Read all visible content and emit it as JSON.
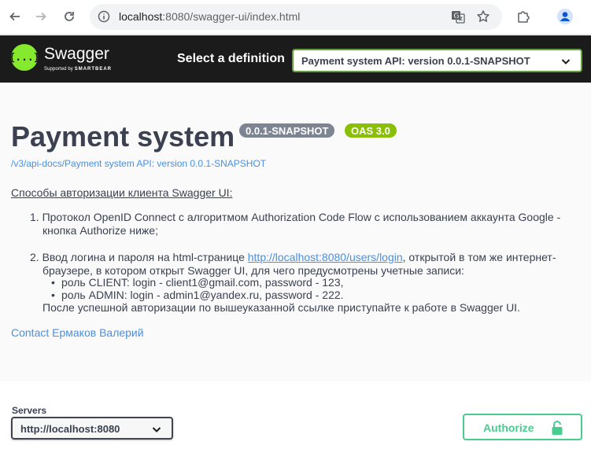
{
  "browser": {
    "url_host": "localhost",
    "url_rest": ":8080/swagger-ui/index.html"
  },
  "topbar": {
    "brand": "Swagger",
    "brand_sub_prefix": "Supported by",
    "brand_sub_company": "SMARTBEAR",
    "select_label": "Select a definition",
    "definition_selected": "Payment system API: version 0.0.1-SNAPSHOT"
  },
  "info": {
    "title": "Payment system",
    "version_badge": "0.0.1-SNAPSHOT",
    "oas_badge": "OAS 3.0",
    "spec_link": "/v3/api-docs/Payment system API: version 0.0.1-SNAPSHOT",
    "desc_heading": "Способы авторизации клиента Swagger UI:",
    "item1_line1": "1. Протокол OpenID Connect с алгоритмом Authorization Code Flow с использованием аккаунта Google -",
    "item1_line2": "кнопка Authorize ниже;",
    "item2_prefix": "2. Ввод логина и пароля на html-странице ",
    "item2_link": "http://localhost:8080/users/login",
    "item2_suffix": ", открытой в том же интернет-",
    "item2_line2": "браузере, в котором открыт Swagger UI, для чего предусмотрены учетные записи:",
    "bullet1": "роль CLIENT: login - client1@gmail.com, password - 123,",
    "bullet2": "роль ADMIN: login - admin1@yandex.ru, password - 222.",
    "after_note": "После успешной авторизации по вышеуказанной ссылке приступайте к работе в Swagger UI.",
    "contact": "Contact Ермаков Валерий"
  },
  "scheme": {
    "servers_label": "Servers",
    "server_selected": "http://localhost:8080",
    "authorize_label": "Authorize"
  },
  "colors": {
    "topbar_bg": "#1b1b1b",
    "accent_green": "#49cc90",
    "oas_badge": "#89bf04",
    "version_badge": "#7d8492",
    "link": "#4990e2"
  },
  "icons": [
    "back-arrow-icon",
    "forward-arrow-icon",
    "reload-icon",
    "site-info-icon",
    "translate-icon",
    "bookmark-star-icon",
    "extensions-icon",
    "profile-icon",
    "chevron-down-icon",
    "lock-icon"
  ]
}
